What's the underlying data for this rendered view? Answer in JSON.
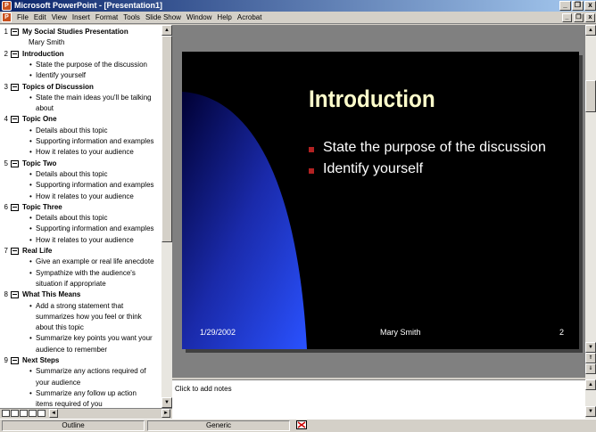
{
  "window": {
    "title": "Microsoft PowerPoint - [Presentation1]",
    "minimize": "_",
    "restore": "❐",
    "close": "x"
  },
  "menu": {
    "items": [
      "File",
      "Edit",
      "View",
      "Insert",
      "Format",
      "Tools",
      "Slide Show",
      "Window",
      "Help",
      "Acrobat"
    ]
  },
  "outline": {
    "slides": [
      {
        "num": "1",
        "title": "My Social Studies Presentation",
        "sub": "Mary Smith",
        "bullets": []
      },
      {
        "num": "2",
        "title": "Introduction",
        "bullets": [
          [
            "State the purpose of the discussion"
          ],
          [
            "Identify yourself"
          ]
        ]
      },
      {
        "num": "3",
        "title": "Topics of Discussion",
        "bullets": [
          [
            "State the main ideas you'll be talking",
            "about"
          ]
        ]
      },
      {
        "num": "4",
        "title": "Topic One",
        "bullets": [
          [
            "Details about this topic"
          ],
          [
            "Supporting information and examples"
          ],
          [
            "How it relates to your audience"
          ]
        ]
      },
      {
        "num": "5",
        "title": "Topic Two",
        "bullets": [
          [
            "Details about this topic"
          ],
          [
            "Supporting information and examples"
          ],
          [
            "How it relates to your audience"
          ]
        ]
      },
      {
        "num": "6",
        "title": "Topic Three",
        "bullets": [
          [
            "Details about this topic"
          ],
          [
            "Supporting information and examples"
          ],
          [
            "How it relates to your audience"
          ]
        ]
      },
      {
        "num": "7",
        "title": "Real Life",
        "bullets": [
          [
            "Give an example or real life anecdote"
          ],
          [
            "Sympathize with the audience's",
            "situation if appropriate"
          ]
        ]
      },
      {
        "num": "8",
        "title": "What This Means",
        "bullets": [
          [
            "Add a strong statement that",
            "summarizes how you feel or think",
            "about this topic"
          ],
          [
            "Summarize key points you want your",
            "audience to remember"
          ]
        ]
      },
      {
        "num": "9",
        "title": "Next Steps",
        "bullets": [
          [
            "Summarize any actions required of",
            "your audience"
          ],
          [
            "Summarize any follow up action",
            "items required of you"
          ]
        ]
      }
    ]
  },
  "slide": {
    "title": "Introduction",
    "bullets": [
      "State the purpose of the discussion",
      "Identify yourself"
    ],
    "footer_date": "1/29/2002",
    "footer_author": "Mary Smith",
    "footer_number": "2",
    "background": "#000000",
    "title_color": "#ffffcc",
    "bullet_color": "#b22222",
    "accent_gradient": [
      "#0000aa",
      "#2a52ff"
    ]
  },
  "notes": {
    "placeholder": "Click to add notes"
  },
  "status": {
    "view": "Outline",
    "design": "Generic"
  }
}
